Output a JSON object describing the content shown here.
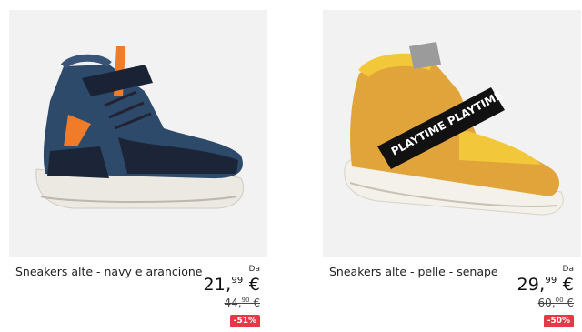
{
  "products": [
    {
      "title": "Sneakers alte - navy e arancione",
      "price_prefix": "Da",
      "price_int": "21,",
      "price_dec": "99",
      "price_cur": " €",
      "old_int": "44,",
      "old_dec": "90",
      "old_cur": " €",
      "discount": "-51%",
      "image_icon": "navy-orange-high-top-sneaker"
    },
    {
      "title": "Sneakers alte - pelle - senape",
      "price_prefix": "Da",
      "price_int": "29,",
      "price_dec": "99",
      "price_cur": " €",
      "old_int": "60,",
      "old_dec": "00",
      "old_cur": " €",
      "discount": "-50%",
      "strap_text": "PLAYTIME PLAYTIME",
      "image_icon": "mustard-leather-high-top-sneaker"
    }
  ],
  "colors": {
    "discount_badge": "#e63946",
    "image_bg": "#f2f2f2"
  }
}
